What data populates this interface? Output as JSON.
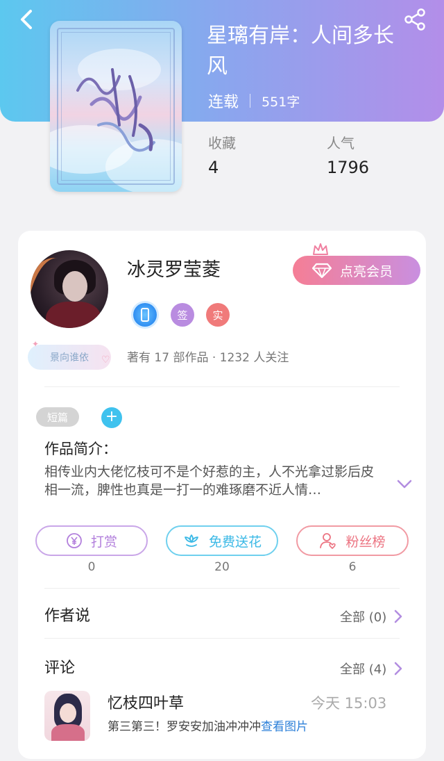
{
  "header": {
    "back_icon": "chevron-left-icon",
    "share_icon": "share-icon"
  },
  "book": {
    "title": "星璃有岸：人间多长风",
    "status": "连载",
    "word_count": "551字",
    "stats": [
      {
        "label": "收藏",
        "value": "4"
      },
      {
        "label": "人气",
        "value": "1796"
      }
    ]
  },
  "author": {
    "name": "冰灵罗莹菱",
    "vip_button_label": "点亮会员",
    "badges": [
      {
        "icon": "phone-verified-icon",
        "text": ""
      },
      {
        "icon": "signed-icon",
        "text": "签"
      },
      {
        "icon": "real-name-icon",
        "text": "实"
      }
    ],
    "tag": "景向谁依",
    "meta": "著有 17 部作品 · 1232 人关注"
  },
  "work": {
    "genre_tag": "短篇",
    "add_tag_symbol": "+",
    "intro_title": "作品简介：",
    "intro_text": "相传业内大佬忆枝可不是个好惹的主，人不光拿过影后皮相一流，脾性也真是一打一的难琢磨不近人情…"
  },
  "actions": [
    {
      "label": "打赏",
      "icon": "yen-coin-icon",
      "count": "0"
    },
    {
      "label": "免费送花",
      "icon": "flower-icon",
      "count": "20"
    },
    {
      "label": "粉丝榜",
      "icon": "fan-ranking-icon",
      "count": "6"
    }
  ],
  "author_says": {
    "title": "作者说",
    "link": "全部 (0)"
  },
  "comments": {
    "title": "评论",
    "link": "全部 (4)",
    "items": [
      {
        "user": "忆枝四叶草",
        "time": "今天 15:03",
        "text": "第三第三！罗安安加油冲冲冲",
        "link_text": "查看图片"
      }
    ]
  },
  "colors": {
    "header_gradient_start": "#5cc8ef",
    "header_gradient_end": "#b38ee9",
    "vip_gradient_start": "#f57e95",
    "vip_gradient_end": "#c98fe0",
    "reward": "#b27fdc",
    "flower": "#3bb9e6",
    "fans": "#ec7482",
    "link": "#2b7fd8"
  }
}
